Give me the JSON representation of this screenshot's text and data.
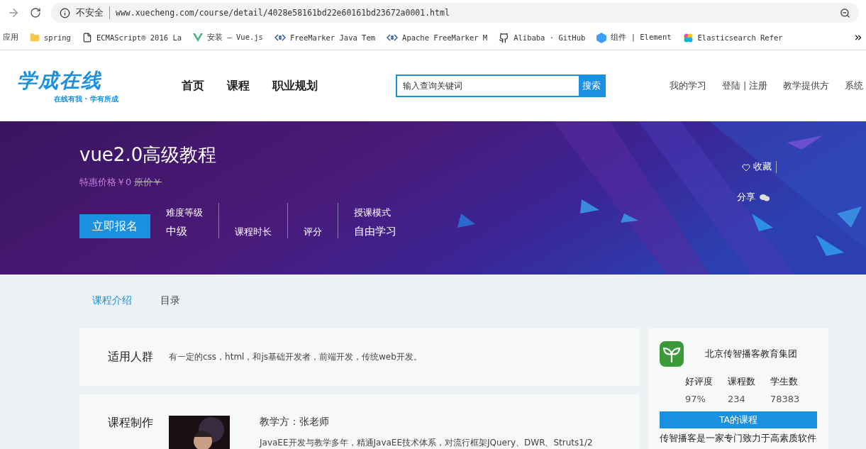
{
  "browser": {
    "security": "不安全",
    "url": "www.xuecheng.com/course/detail/4028e58161bd22e60161bd23672a0001.html"
  },
  "bookmarks": [
    {
      "label": "应用",
      "kind": "apps"
    },
    {
      "label": "spring",
      "kind": "folder"
    },
    {
      "label": "ECMAScript® 2016 La",
      "kind": "page"
    },
    {
      "label": "安装 — Vue.js",
      "kind": "vue"
    },
    {
      "label": "FreeMarker Java Tem",
      "kind": "code"
    },
    {
      "label": "Apache FreeMarker M",
      "kind": "code"
    },
    {
      "label": "Alibaba · GitHub",
      "kind": "github"
    },
    {
      "label": "组件 | Element",
      "kind": "element"
    },
    {
      "label": "Elasticsearch Refer",
      "kind": "elastic"
    }
  ],
  "header": {
    "logo_title": "学成在线",
    "logo_slogan": "在线有我 · 学有所成",
    "nav": [
      {
        "label": "首页"
      },
      {
        "label": "课程"
      },
      {
        "label": "职业规划"
      }
    ],
    "search": {
      "placeholder": "输入查询关键词",
      "button": "搜索"
    },
    "links": [
      {
        "label": "我的学习"
      },
      {
        "label": "登陆 | 注册"
      },
      {
        "label": "教学提供方"
      },
      {
        "label": "系统"
      }
    ]
  },
  "course": {
    "title": "vue2.0高级教程",
    "price": "特惠价格￥0",
    "original_price": "原价￥",
    "enroll": "立即报名",
    "favorite": "收藏",
    "share": "分享",
    "stats": [
      {
        "label": "难度等级",
        "value": "中级"
      },
      {
        "label": "课程时长"
      },
      {
        "label": "评分"
      },
      {
        "label": "授课模式",
        "value": "自由学习"
      }
    ]
  },
  "tabs": [
    {
      "label": "课程介绍",
      "selected": true
    },
    {
      "label": "目录",
      "selected": false
    }
  ],
  "sections": [
    {
      "heading": "适用人群",
      "text": "有一定的css，html，和js基础开发者，前端开发，传统web开发。"
    },
    {
      "heading": "课程制作",
      "teacher": "教学方：张老师",
      "bio": "JavaEE开发与教学多年，精通JavaEE技术体系，对流行框架JQuery、DWR、Struts1/2"
    }
  ],
  "provider": {
    "name": "北京传智播客教育集团",
    "stats": [
      {
        "label": "好评度",
        "value": "97%"
      },
      {
        "label": "课程数",
        "value": "234"
      },
      {
        "label": "学生数",
        "value": "78383"
      }
    ],
    "button": "TA的课程",
    "intro": "传智播客是一家专门致力于高素质软件"
  }
}
